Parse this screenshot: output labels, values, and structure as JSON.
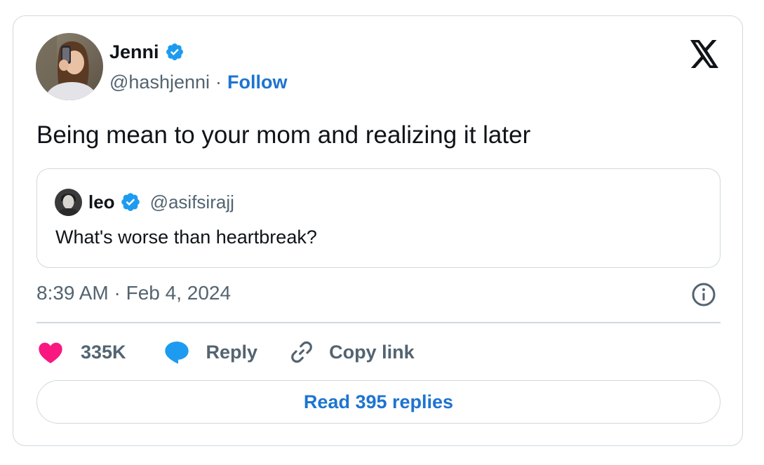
{
  "tweet": {
    "author": {
      "name": "Jenni",
      "handle": "@hashjenni",
      "verified": true
    },
    "follow_label": "Follow",
    "separator": "·",
    "text": "Being mean to your mom and realizing it later",
    "quoted": {
      "author": {
        "name": "leo",
        "handle": "@asifsirajj",
        "verified": true
      },
      "text": "What's worse than heartbreak?"
    },
    "timestamp": "8:39 AM · Feb 4, 2024",
    "actions": {
      "like_count": "335K",
      "reply_label": "Reply",
      "copy_link_label": "Copy link"
    },
    "read_replies_label": "Read 395 replies"
  },
  "icons": {
    "logo": "x-logo-icon",
    "verified": "verified-badge-icon",
    "info": "info-icon",
    "like": "heart-icon",
    "reply": "speech-bubble-icon",
    "copy": "link-icon"
  },
  "colors": {
    "link_blue": "#1d74d0",
    "verified_blue": "#1d9bf0",
    "heart_pink": "#f91880",
    "muted_text": "#536471",
    "border": "#cfd9de"
  }
}
